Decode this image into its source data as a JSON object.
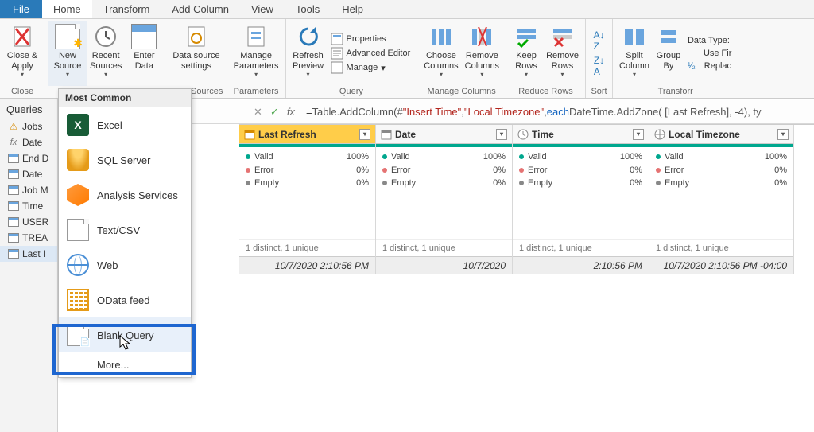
{
  "menubar": {
    "file": "File",
    "tabs": [
      "Home",
      "Transform",
      "Add Column",
      "View",
      "Tools",
      "Help"
    ],
    "active": 0
  },
  "ribbon": {
    "close": {
      "close_apply": "Close &\nApply",
      "group": "Close"
    },
    "new_data": {
      "new_source": "New\nSource",
      "recent_sources": "Recent\nSources",
      "enter_data": "Enter\nData"
    },
    "data_sources": {
      "settings": "Data source\nsettings",
      "group": "Data Sources"
    },
    "parameters": {
      "manage": "Manage\nParameters",
      "group": "Parameters"
    },
    "query": {
      "refresh": "Refresh\nPreview",
      "properties": "Properties",
      "advanced": "Advanced Editor",
      "manage": "Manage",
      "group": "Query"
    },
    "manage_cols": {
      "choose": "Choose\nColumns",
      "remove": "Remove\nColumns",
      "group": "Manage Columns"
    },
    "reduce_rows": {
      "keep": "Keep\nRows",
      "remove": "Remove\nRows",
      "group": "Reduce Rows"
    },
    "sort": {
      "group": "Sort"
    },
    "transform": {
      "split": "Split\nColumn",
      "group_by": "Group\nBy",
      "data_type": "Data Type:",
      "use_first": "Use Fir",
      "replace": "Replac",
      "group": "Transforr"
    }
  },
  "sidebar": {
    "header": "Queries",
    "items": [
      {
        "label": "Jobs",
        "icon": "warn"
      },
      {
        "label": "Date",
        "icon": "fx"
      },
      {
        "label": "End D",
        "icon": "table"
      },
      {
        "label": "Date",
        "icon": "table"
      },
      {
        "label": "Job M",
        "icon": "table"
      },
      {
        "label": "Time",
        "icon": "table"
      },
      {
        "label": "USER",
        "icon": "table"
      },
      {
        "label": "TREA",
        "icon": "table"
      },
      {
        "label": "Last I",
        "icon": "table",
        "selected": true
      }
    ]
  },
  "popup": {
    "header": "Most Common",
    "items": [
      {
        "label": "Excel",
        "icon": "excel"
      },
      {
        "label": "SQL Server",
        "icon": "db"
      },
      {
        "label": "Analysis Services",
        "icon": "cube"
      },
      {
        "label": "Text/CSV",
        "icon": "page"
      },
      {
        "label": "Web",
        "icon": "globe"
      },
      {
        "label": "OData feed",
        "icon": "grid"
      },
      {
        "label": "Blank Query",
        "icon": "page",
        "hover": true
      }
    ],
    "more": "More..."
  },
  "formula": {
    "eq": "= ",
    "p1": "Table.AddColumn(#",
    "s1": "\"Insert Time\"",
    "p2": ", ",
    "s2": "\"Local Timezone\"",
    "p3": ", ",
    "kw": "each",
    "p4": " DateTime.AddZone( [Last Refresh], -4), ty"
  },
  "grid": {
    "columns": [
      {
        "name": "Last Refresh",
        "icon": "datetime",
        "selected": true
      },
      {
        "name": "Date",
        "icon": "date"
      },
      {
        "name": "Time",
        "icon": "time"
      },
      {
        "name": "Local Timezone",
        "icon": "tz"
      }
    ],
    "stats": {
      "valid": {
        "label": "Valid",
        "pct": "100%",
        "color": "#00a78e"
      },
      "error": {
        "label": "Error",
        "pct": "0%",
        "color": "#e57373"
      },
      "empty": {
        "label": "Empty",
        "pct": "0%",
        "color": "#888"
      }
    },
    "distinct": "1 distinct, 1 unique",
    "values": [
      "10/7/2020 2:10:56 PM",
      "10/7/2020",
      "2:10:56 PM",
      "10/7/2020 2:10:56 PM -04:00"
    ]
  },
  "fbar_icons": {
    "check": "✓",
    "fx_label": "fx"
  }
}
